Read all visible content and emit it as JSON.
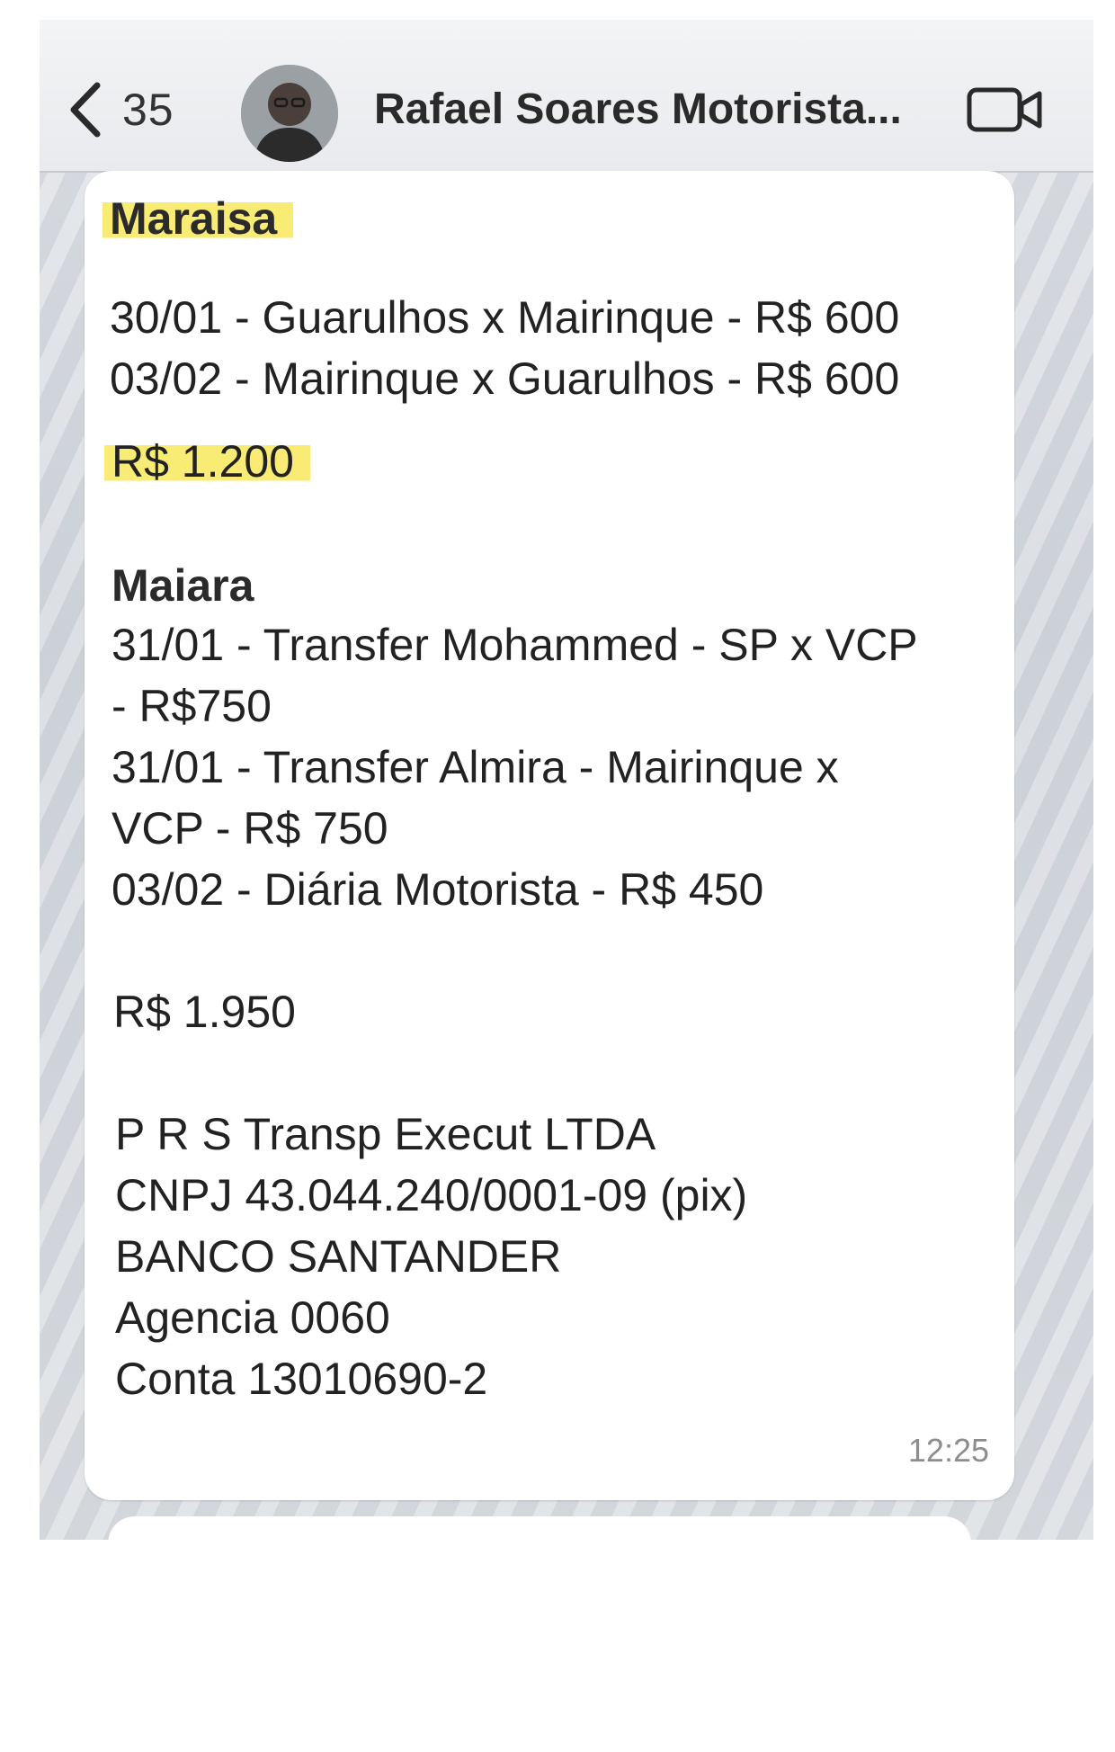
{
  "header": {
    "back_count": "35",
    "contact_name": "Rafael Soares Motorista..."
  },
  "message": {
    "lines": [
      "Maraisa",
      "30/01 - Guarulhos x Mairinque - R$ 600",
      "03/02 - Mairinque x Guarulhos - R$ 600",
      "R$ 1.200",
      "Maiara",
      "31/01 - Transfer Mohammed - SP x VCP",
      "- R$750",
      "31/01 - Transfer Almira - Mairinque x",
      "VCP - R$ 750",
      "03/02 - Diária Motorista - R$ 450",
      "R$ 1.950",
      "P R S Transp Execut LTDA",
      "CNPJ  43.044.240/0001-09 (pix)",
      "BANCO SANTANDER",
      "Agencia 0060",
      "Conta 13010690-2"
    ],
    "time": "12:25"
  },
  "colors": {
    "highlight": "#f8e85c",
    "header_bg": "#f0f1f3",
    "bubble_bg": "#ffffff",
    "timestamp": "#8d8d8d"
  },
  "icons": [
    "chevron-left-icon",
    "video-call-icon"
  ]
}
